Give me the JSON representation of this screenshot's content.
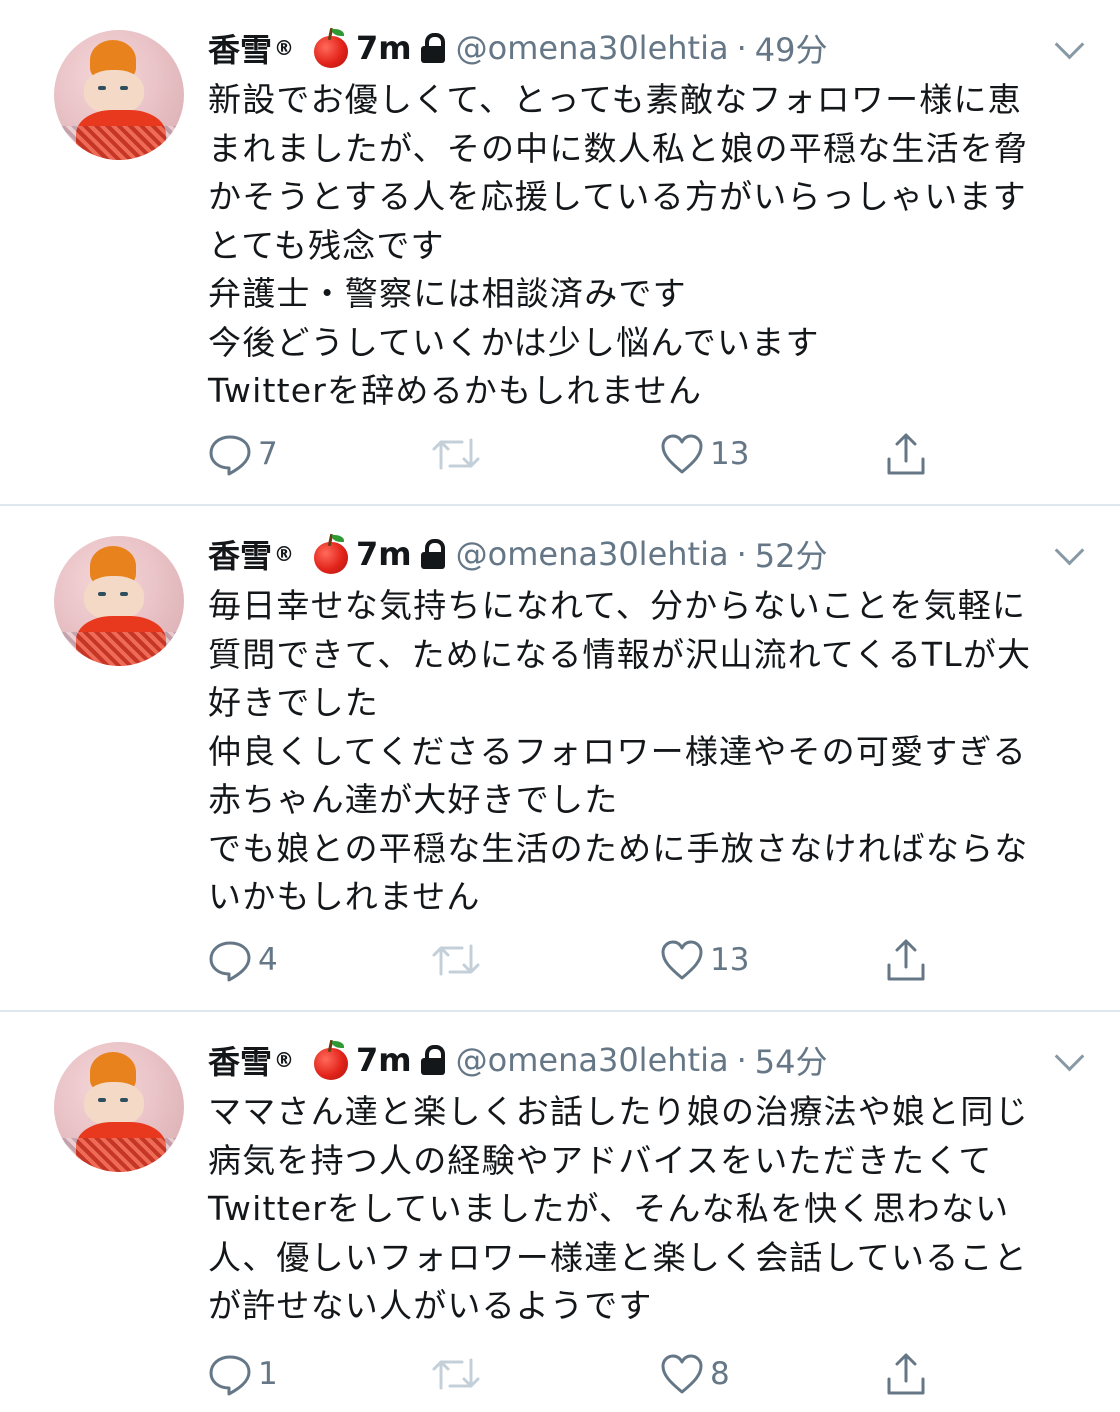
{
  "tweets": [
    {
      "name": "香雪",
      "reg": "®",
      "badge_text": "7m",
      "handle": "@omena30lehtia",
      "separator": "·",
      "time": "49分",
      "text": "新設でお優しくて、とっても素敵なフォロワー様に恵\nまれましたが、その中に数人私と娘の平穏な生活を脅\nかそうとする人を応援している方がいらっしゃいます\nとても残念です\n弁護士・警察には相談済みです\n今後どうしていくかは少し悩んでいます\nTwitterを辞めるかもしれません",
      "reply_count": "7",
      "retweet_count": "",
      "like_count": "13"
    },
    {
      "name": "香雪",
      "reg": "®",
      "badge_text": "7m",
      "handle": "@omena30lehtia",
      "separator": "·",
      "time": "52分",
      "text": "毎日幸せな気持ちになれて、分からないことを気軽に\n質問できて、ためになる情報が沢山流れてくるTLが大\n好きでした\n仲良くしてくださるフォロワー様達やその可愛すぎる\n赤ちゃん達が大好きでした\nでも娘との平穏な生活のために手放さなければならな\nいかもしれません",
      "reply_count": "4",
      "retweet_count": "",
      "like_count": "13"
    },
    {
      "name": "香雪",
      "reg": "®",
      "badge_text": "7m",
      "handle": "@omena30lehtia",
      "separator": "·",
      "time": "54分",
      "text": "ママさん達と楽しくお話したり娘の治療法や娘と同じ\n病気を持つ人の経験やアドバイスをいただきたくて\nTwitterをしていましたが、そんな私を快く思わない\n人、優しいフォロワー様達と楽しく会話していること\nが許せない人がいるようです",
      "reply_count": "1",
      "retweet_count": "",
      "like_count": "8"
    }
  ],
  "icons": {
    "reply": "reply-icon",
    "retweet": "retweet-icon",
    "like": "heart-icon",
    "share": "share-icon",
    "lock": "lock-icon",
    "apple": "apple-emoji-icon",
    "chevron": "chevron-down-icon"
  },
  "colors": {
    "text": "#14171a",
    "secondary": "#657786",
    "divider": "#e1e8ed",
    "retweet_disabled": "#c4d0d9"
  }
}
